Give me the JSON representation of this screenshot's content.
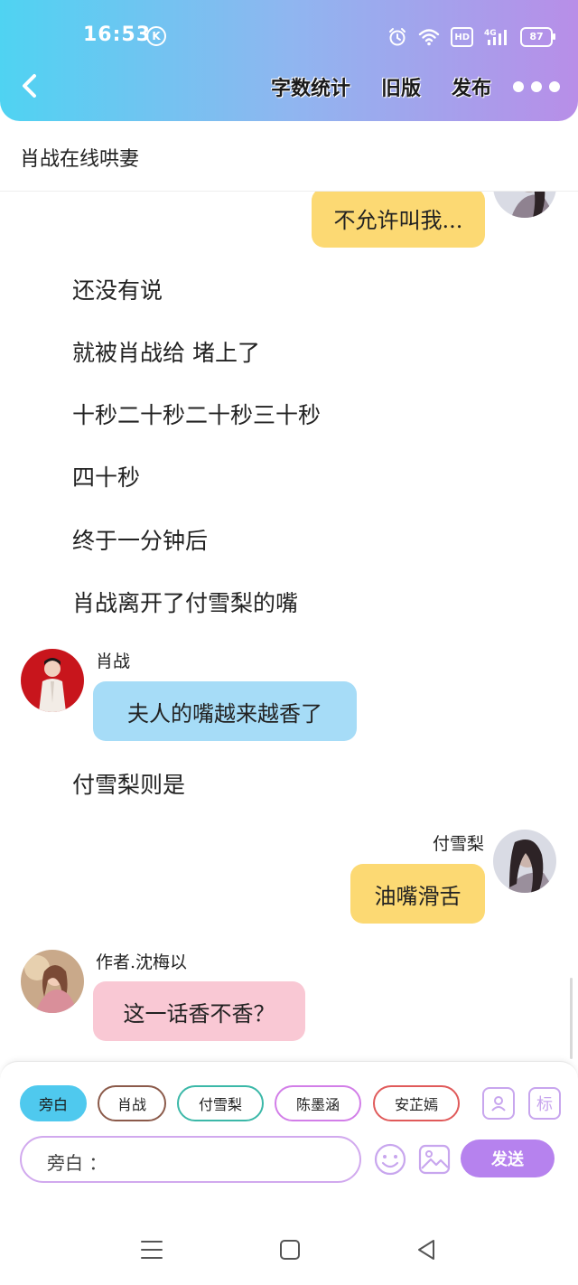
{
  "status_bar": {
    "time": "16:53",
    "k_badge": "K",
    "hd_label": "HD",
    "network": "4G",
    "battery": "87"
  },
  "header": {
    "actions": [
      "字数统计",
      "旧版",
      "发布"
    ]
  },
  "title": "肖战在线哄妻",
  "messages": [
    {
      "type": "right",
      "speaker": "",
      "text": "不允许叫我...",
      "color": "yellow"
    },
    {
      "type": "narration",
      "text": "还没有说"
    },
    {
      "type": "narration",
      "text": "就被肖战给 堵上了"
    },
    {
      "type": "narration",
      "text": "十秒二十秒二十秒三十秒"
    },
    {
      "type": "narration",
      "text": "四十秒"
    },
    {
      "type": "narration",
      "text": "终于一分钟后"
    },
    {
      "type": "narration",
      "text": "肖战离开了付雪梨的嘴"
    },
    {
      "type": "left",
      "speaker": "肖战",
      "text": "夫人的嘴越来越香了",
      "color": "blue"
    },
    {
      "type": "narration",
      "text": "付雪梨则是"
    },
    {
      "type": "right",
      "speaker": "付雪梨",
      "text": "油嘴滑舌",
      "color": "yellow"
    },
    {
      "type": "left",
      "speaker": "作者.沈梅以",
      "text": "这一话香不香？",
      "color": "pink"
    }
  ],
  "roles": [
    {
      "label": "旁白",
      "border": "#4fc9ee",
      "active": true
    },
    {
      "label": "肖战",
      "border": "#8b5a4a",
      "active": false
    },
    {
      "label": "付雪梨",
      "border": "#3bb8a8",
      "active": false
    },
    {
      "label": "陈墨涵",
      "border": "#d27ee8",
      "active": false
    },
    {
      "label": "安芷嫣",
      "border": "#e05a5a",
      "active": false
    }
  ],
  "tools": {
    "mark_label": "标"
  },
  "input": {
    "placeholder": "旁白 ："
  },
  "send_label": "发送",
  "colors": {
    "accent": "#b682ee",
    "bubble_yellow": "#fcd973",
    "bubble_blue": "#a6dcf7",
    "bubble_pink": "#f9c8d4"
  }
}
